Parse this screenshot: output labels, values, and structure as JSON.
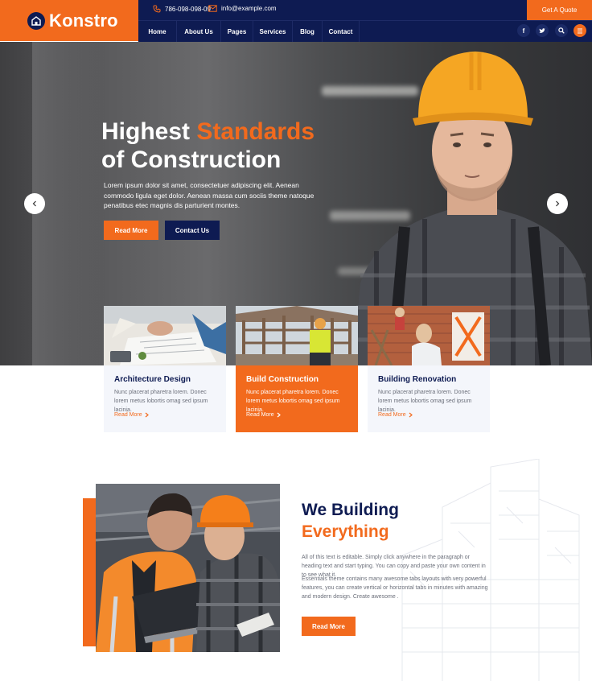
{
  "brand": {
    "name": "Konstro",
    "accent": "#f26a1d",
    "navy": "#0e1b52"
  },
  "topbar": {
    "phone": "786-098-098-09",
    "email": "info@example.com",
    "quote_label": "Get A Quote"
  },
  "nav": {
    "items": [
      "Home",
      "About Us",
      "Pages",
      "Services",
      "Blog",
      "Contact"
    ]
  },
  "social": {
    "facebook": "f",
    "twitter": "t"
  },
  "hero": {
    "title_line1_plain": "Highest ",
    "title_line1_accent": "Standards",
    "title_line2": "of Construction",
    "text": "Lorem ipsum dolor sit amet, consectetuer adipiscing elit. Aenean commodo ligula eget dolor. Aenean massa cum sociis theme natoque penatibus etec magnis dis parturient montes.",
    "primary_label": "Read More",
    "secondary_label": "Contact Us"
  },
  "services": [
    {
      "title": "Architecture Design",
      "text": "Nunc placerat pharetra lorem. Donec lorem metus lobortis omag sed ipsum lacinia.",
      "link": "Read More"
    },
    {
      "title": "Build Construction",
      "text": "Nunc placerat pharetra lorem. Donec lorem metus lobortis omag sed ipsum lacinia.",
      "link": "Read More"
    },
    {
      "title": "Building Renovation",
      "text": "Nunc placerat pharetra lorem. Donec lorem metus lobortis omag sed ipsum lacinia.",
      "link": "Read More"
    }
  ],
  "about": {
    "title_line1": "We Building",
    "title_line2": "Everything",
    "p1": "All of this text is editable. Simply click anywhere in the paragraph or heading text and start typing. You can copy and paste your own content in to see what it.",
    "p2": "Essentials theme contains many awesome tabs layouts with very powerful features, you can create vertical or horizontal tabs in minutes with amazing and modern design. Create awesome .",
    "button_label": "Read More"
  },
  "icons": [
    "logo-icon",
    "phone-icon",
    "mail-icon",
    "facebook-icon",
    "twitter-icon",
    "search-icon",
    "menu-icon",
    "chevron-left-icon",
    "chevron-right-icon",
    "chevron-right-small-icon"
  ]
}
